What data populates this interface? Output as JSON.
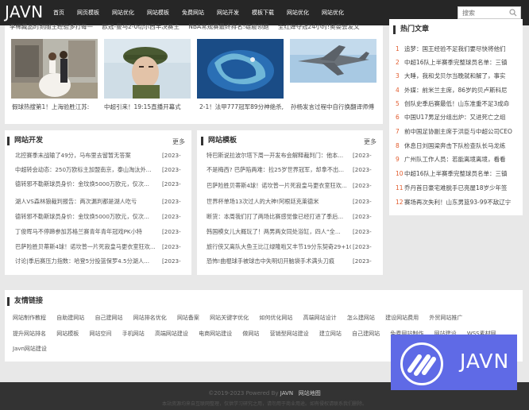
{
  "site": {
    "logo": "JAVN"
  },
  "nav": [
    "首页",
    "网页模板",
    "网站优化",
    "网站模板",
    "免费网站",
    "网站开发",
    "模板下载",
    "网站优化",
    "网站优化"
  ],
  "search": {
    "placeholder": "搜索"
  },
  "top_strip": [
    "李稀藏品时刻随主经验多打每一",
    "欧冠-曼马2-0切尔西半决赛主",
    "NBA常规赛最终排名!雄鹿领跑",
    "全红婵夺冠24小时!奥委会发文"
  ],
  "featured": [
    {
      "caption": "假球热搜第1！上海验胜江苏:"
    },
    {
      "caption": "中超引来！19:15直播开幕式"
    },
    {
      "caption": "2-1！法甲777冠军89分神绝杀,"
    },
    {
      "caption": "孙杨发言过程中自行换翻译师傅"
    }
  ],
  "dev": {
    "title": "网站开发",
    "more": "更多",
    "items": [
      {
        "t": "北控赛季末战输了49分，马布里去留暂无答案",
        "d": "[2023-"
      },
      {
        "t": "中超转会动态：250万欧标主加盟南京，泰山淘汰外...",
        "d": "[2023-"
      },
      {
        "t": "德转邪不勒斯球员身价：金玟焕5000万欧元，仅次...",
        "d": "[2023-"
      },
      {
        "t": "湖人VS森林狼裁判报告：两次漏判都是湖人吃亏",
        "d": "[2023-"
      },
      {
        "t": "德转邪不勒斯球员身价：金玟焕5000万欧元，仅次...",
        "d": "[2023-"
      },
      {
        "t": "丁俊晖马不停蹄参加苏格兰赛青年青年冠戏PK小特",
        "d": "[2023-"
      },
      {
        "t": "巴萨险胜贝蒂斯4球！诺坎普一片死寂皇马更衣室狂欢...",
        "d": "[2023-"
      },
      {
        "t": "讨论|季后赛压力指数：哈登5分投篮保罗4.5分湖人...",
        "d": "[2023-"
      }
    ]
  },
  "tpl": {
    "title": "网站模板",
    "more": "更多",
    "items": [
      {
        "t": "特巴斯说拉波尔塔下周一开发布会解释裁判门：他本...",
        "d": "[2023-"
      },
      {
        "t": "不是梅西? 巴萨陷两难：拉25岁世界冠军，却拿不出...",
        "d": "[2023-"
      },
      {
        "t": "巴萨险胜贝蒂斯4球！诺坎普一片死寂皇马更衣室狂欢...",
        "d": "[2023-"
      },
      {
        "t": "世界杯单场13次过人的大神!阿根廷克莱德米",
        "d": "[2023-"
      },
      {
        "t": "断货：本周我们打了两场比赛感觉像已经打进了季后...",
        "d": "[2023-"
      },
      {
        "t": "韩国模女儿大概玩了！两男两女同处浴缸，四人“全...",
        "d": "[2023-"
      },
      {
        "t": "旅行侠又离队大鱼王比江绿隆啦又丰节19分东契奇29+10+6",
        "d": "[2023-"
      },
      {
        "t": "恐怖!曲棍球手被球击中失明切开脑袋手术满头刀痕",
        "d": "[2023-"
      }
    ]
  },
  "hot": {
    "title": "热门文章",
    "items": [
      {
        "n": "1",
        "t": "追梦：国王经验不足我们要尽快将他们"
      },
      {
        "n": "2",
        "t": "中超16队上半赛季完整球员名单：三镇"
      },
      {
        "n": "3",
        "t": "大睡，我和戈贝尔当晚就和解了，事实"
      },
      {
        "n": "4",
        "t": "外媒：前米兰主席，86岁的贝卢斯科尼"
      },
      {
        "n": "5",
        "t": "创队史季后赛最低！山东准重不足3成命"
      },
      {
        "n": "6",
        "t": "中国U17男足分组出炉：又进死亡之组"
      },
      {
        "n": "7",
        "t": "前中国足协副主席于洪臣与中超公司CEO"
      },
      {
        "n": "8",
        "t": "休息日刘国梁奔击下队检查队长马龙练"
      },
      {
        "n": "9",
        "t": "广州队工作人员：若能离境离境，看看"
      },
      {
        "n": "10",
        "t": "中超16队上半赛季完整球员名单：三镇"
      },
      {
        "n": "11",
        "t": "乔丹首日豪宅难脱手已亮屋18岁少年签"
      },
      {
        "n": "12",
        "t": "赛场再次失利！山东男篮93-99不敌辽宁"
      }
    ]
  },
  "friend_links": {
    "title": "友情链接",
    "rows": [
      [
        "网站制作教程",
        "自助建网站",
        "自己建网站",
        "网站排名优化",
        "网站备案",
        "网站关键字优化",
        "如何优化网站",
        "高端网站设计",
        "怎么建网站",
        "建设网站费用",
        "外贸网站推广"
      ],
      [
        "提升网站排名",
        "网站模板",
        "网站空间",
        "手机网站",
        "高端网站建设",
        "电商网站建设",
        "做网站",
        "营销型网站建设",
        "建立网站",
        "自己建网站",
        "免费网站制作",
        "网站建设",
        "WSS素材网"
      ],
      [
        "Javn网站建设"
      ]
    ]
  },
  "footer": {
    "copyright": "©2019-2023 Powered By",
    "brand": "JAVN",
    "sitemap": "网站地图",
    "disclaimer": "本站资源均来自互联网整理，仅供学习研究之用，请勿用于商业用途。如有侵权请联系我们删除。"
  },
  "badge": {
    "text": "JAVN"
  }
}
